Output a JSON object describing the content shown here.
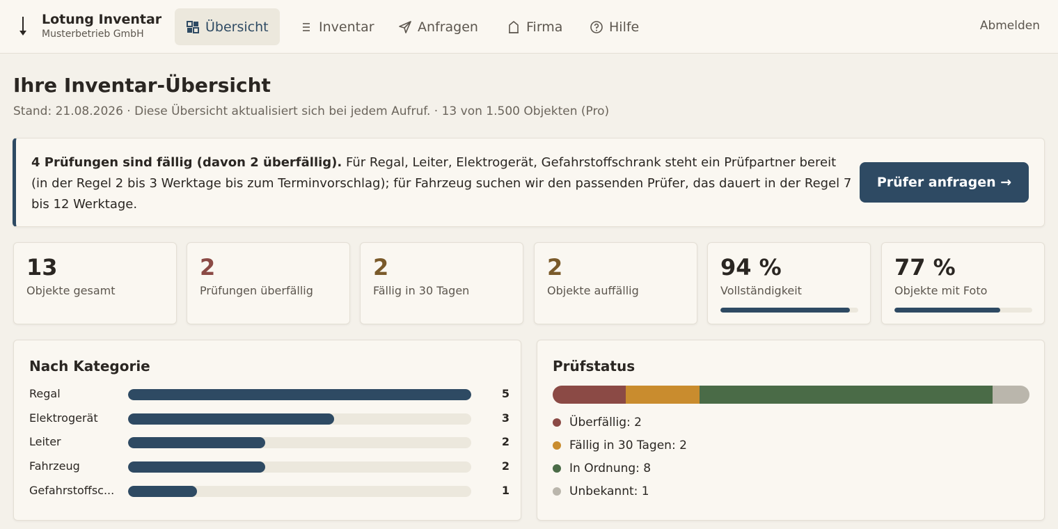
{
  "brand": {
    "title": "Lotung Inventar",
    "subtitle": "Musterbetrieb GmbH"
  },
  "nav": [
    {
      "label": "Übersicht",
      "icon": "grid-icon",
      "active": true
    },
    {
      "label": "Inventar",
      "icon": "list-icon",
      "active": false
    },
    {
      "label": "Anfragen",
      "icon": "send-icon",
      "active": false
    },
    {
      "label": "Firma",
      "icon": "building-icon",
      "active": false
    },
    {
      "label": "Hilfe",
      "icon": "help-icon",
      "active": false
    }
  ],
  "logout_label": "Abmelden",
  "page": {
    "title": "Ihre Inventar-Übersicht",
    "subtitle": "Stand: 21.08.2026 · Diese Übersicht aktualisiert sich bei jedem Aufruf. · 13 von 1.500 Objekten (Pro)"
  },
  "alert": {
    "strong": "4 Prüfungen sind fällig (davon 2 überfällig).",
    "text": " Für Regal, Leiter, Elektrogerät, Gefahrstoffschrank steht ein Prüfpartner bereit (in der Regel 2 bis 3 Werktage bis zum Terminvorschlag); für Fahrzeug suchen wir den passenden Prüfer, das dauert in der Regel 7 bis 12 Werktage.",
    "button": "Prüfer anfragen →"
  },
  "stats": [
    {
      "value": "13",
      "label": "Objekte gesamt",
      "color": "#2a2622"
    },
    {
      "value": "2",
      "label": "Prüfungen überfällig",
      "color": "#8b4a45"
    },
    {
      "value": "2",
      "label": "Fällig in 30 Tagen",
      "color": "#7a5a2a"
    },
    {
      "value": "2",
      "label": "Objekte auffällig",
      "color": "#7a5a2a"
    },
    {
      "value": "94 %",
      "label": "Vollständigkeit",
      "color": "#2a2622",
      "progress": 0.94
    },
    {
      "value": "77 %",
      "label": "Objekte mit Foto",
      "color": "#2a2622",
      "progress": 0.77
    }
  ],
  "category_panel": {
    "title": "Nach Kategorie",
    "max": 5,
    "items": [
      {
        "label": "Regal",
        "count": 5
      },
      {
        "label": "Elektrogerät",
        "count": 3
      },
      {
        "label": "Leiter",
        "count": 2
      },
      {
        "label": "Fahrzeug",
        "count": 2
      },
      {
        "label": "Gefahrstoffsc...",
        "count": 1
      }
    ]
  },
  "status_panel": {
    "title": "Prüfstatus",
    "total": 13,
    "items": [
      {
        "label": "Überfällig: 2",
        "count": 2,
        "color": "#8b4a45"
      },
      {
        "label": "Fällig in 30 Tagen: 2",
        "count": 2,
        "color": "#c98c2e"
      },
      {
        "label": "In Ordnung: 8",
        "count": 8,
        "color": "#4a6b47"
      },
      {
        "label": "Unbekannt: 1",
        "count": 1,
        "color": "#bab6ac"
      }
    ]
  },
  "colors": {
    "accent": "#2e4a63",
    "background": "#f4f1ea",
    "card": "#faf7f1"
  }
}
